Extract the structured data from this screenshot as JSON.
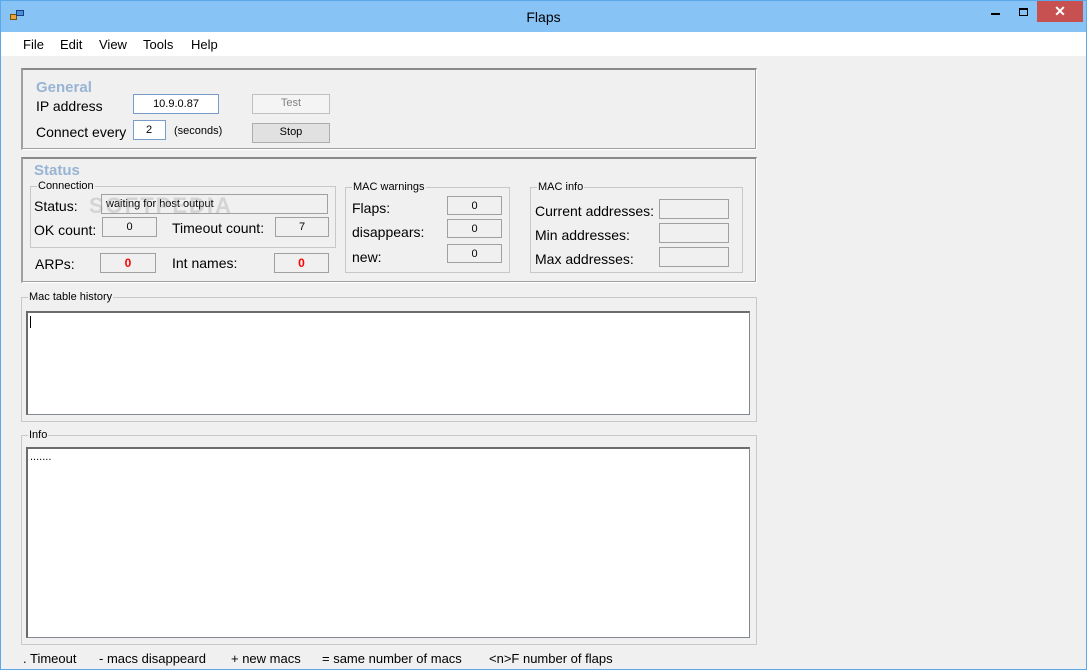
{
  "window": {
    "title": "Flaps"
  },
  "menu": [
    "File",
    "Edit",
    "View",
    "Tools",
    "Help"
  ],
  "general": {
    "title": "General",
    "ip_label": "IP address",
    "ip_value": "10.9.0.87",
    "connect_label": "Connect every",
    "connect_value": "2",
    "seconds_label": "(seconds)",
    "test_button": "Test",
    "stop_button": "Stop"
  },
  "status": {
    "title": "Status",
    "connection": {
      "title": "Connection",
      "status_label": "Status:",
      "status_value": "waiting for host output",
      "ok_label": "OK count:",
      "ok_value": "0",
      "timeout_label": "Timeout count:",
      "timeout_value": "7",
      "arps_label": "ARPs:",
      "arps_value": "0",
      "intnames_label": "Int names:",
      "intnames_value": "0"
    },
    "mac_warnings": {
      "title": "MAC warnings",
      "flaps_label": "Flaps:",
      "flaps_value": "0",
      "disappears_label": "disappears:",
      "disappears_value": "0",
      "new_label": "new:",
      "new_value": "0"
    },
    "mac_info": {
      "title": "MAC info",
      "current_label": "Current addresses:",
      "current_value": "",
      "min_label": "Min addresses:",
      "min_value": "",
      "max_label": "Max addresses:",
      "max_value": ""
    }
  },
  "mac_history": {
    "title": "Mac table  history",
    "content": ""
  },
  "info": {
    "title": "Info",
    "content": "......."
  },
  "legend": [
    ". Timeout",
    "- macs disappeard",
    "+ new macs",
    "= same number of macs",
    "<n>F number of flaps"
  ],
  "watermark": "SOFTPEDIA",
  "colors": {
    "titlebar": "#88c3f5",
    "close": "#c75050",
    "section_title": "#98b4d4",
    "alert": "#ff0000"
  }
}
